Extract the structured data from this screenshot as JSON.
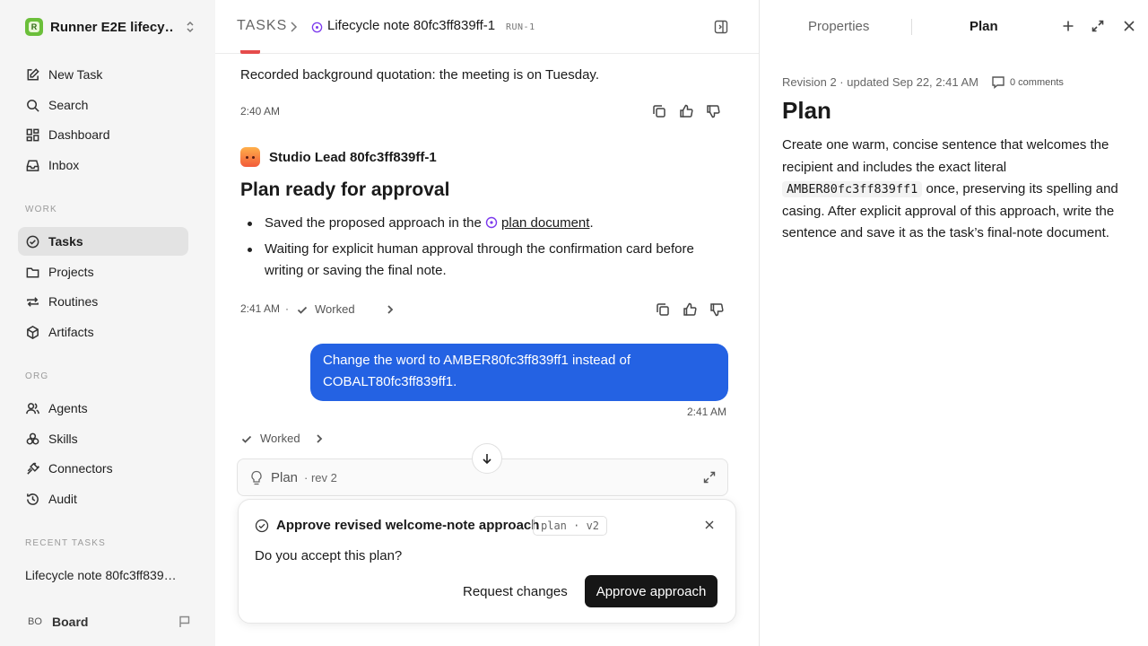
{
  "sidebar": {
    "workspace_name": "Runner E2E lifecy…",
    "top_nav": [
      {
        "label": "New Task",
        "icon": "edit-icon"
      },
      {
        "label": "Search",
        "icon": "search-icon"
      },
      {
        "label": "Dashboard",
        "icon": "dashboard-icon"
      },
      {
        "label": "Inbox",
        "icon": "inbox-icon"
      }
    ],
    "work_label": "WORK",
    "work_nav": [
      {
        "label": "Tasks",
        "icon": "check-circle-icon",
        "active": true
      },
      {
        "label": "Projects",
        "icon": "folder-icon"
      },
      {
        "label": "Routines",
        "icon": "repeat-icon"
      },
      {
        "label": "Artifacts",
        "icon": "box-icon"
      }
    ],
    "org_label": "ORG",
    "org_nav": [
      {
        "label": "Agents",
        "icon": "users-icon"
      },
      {
        "label": "Skills",
        "icon": "skills-icon"
      },
      {
        "label": "Connectors",
        "icon": "plug-icon"
      },
      {
        "label": "Audit",
        "icon": "history-icon"
      }
    ],
    "recent_label": "RECENT TASKS",
    "recent_task": "Lifecycle note 80fc3ff839…",
    "user_initials": "BO",
    "user_name": "Board"
  },
  "topbar": {
    "root": "TASKS",
    "title": "Lifecycle note 80fc3ff839ff-1",
    "run_badge": "RUN-1"
  },
  "conversation": {
    "msg1_text": "Recorded background quotation: the meeting is on Tuesday.",
    "msg1_time": "2:40 AM",
    "agent_name": "Studio Lead 80fc3ff839ff-1",
    "plan_heading": "Plan ready for approval",
    "bullet1_prefix": "Saved the proposed approach in the",
    "bullet1_link": "plan document",
    "bullet1_suffix": ".",
    "bullet2": "Waiting for explicit human approval through the confirmation card before writing or saving the final note.",
    "msg2_time": "2:41 AM",
    "msg2_sep": "·",
    "worked_label": "Worked",
    "user_msg": "Change the word to AMBER80fc3ff839ff1 instead of COBALT80fc3ff839ff1.",
    "user_time": "2:41 AM",
    "worked2_label": "Worked",
    "plan_card_title": "Plan",
    "plan_card_rev": "· rev 2"
  },
  "confirm": {
    "title": "Approve revised welcome-note approach",
    "badge": "plan · v2",
    "question": "Do you accept this plan?",
    "request_label": "Request changes",
    "approve_label": "Approve approach"
  },
  "right_panel": {
    "tab_properties": "Properties",
    "tab_plan": "Plan",
    "meta": "Revision 2 · updated Sep 22, 2:41 AM",
    "comments": "0 comments",
    "title": "Plan",
    "body_part1": "Create one warm, concise sentence that welcomes the recipient and includes the exact literal",
    "body_code": "AMBER80fc3ff839ff1",
    "body_part2": "once, preserving its spelling and casing. After explicit approval of this approach, write the sentence and save it as the task’s final-note document."
  },
  "colors": {
    "accent_blue": "#2462e3",
    "primary_button": "#161616",
    "plan_icon_purple": "#7c3aed",
    "sidebar_bg": "#f5f5f5"
  }
}
